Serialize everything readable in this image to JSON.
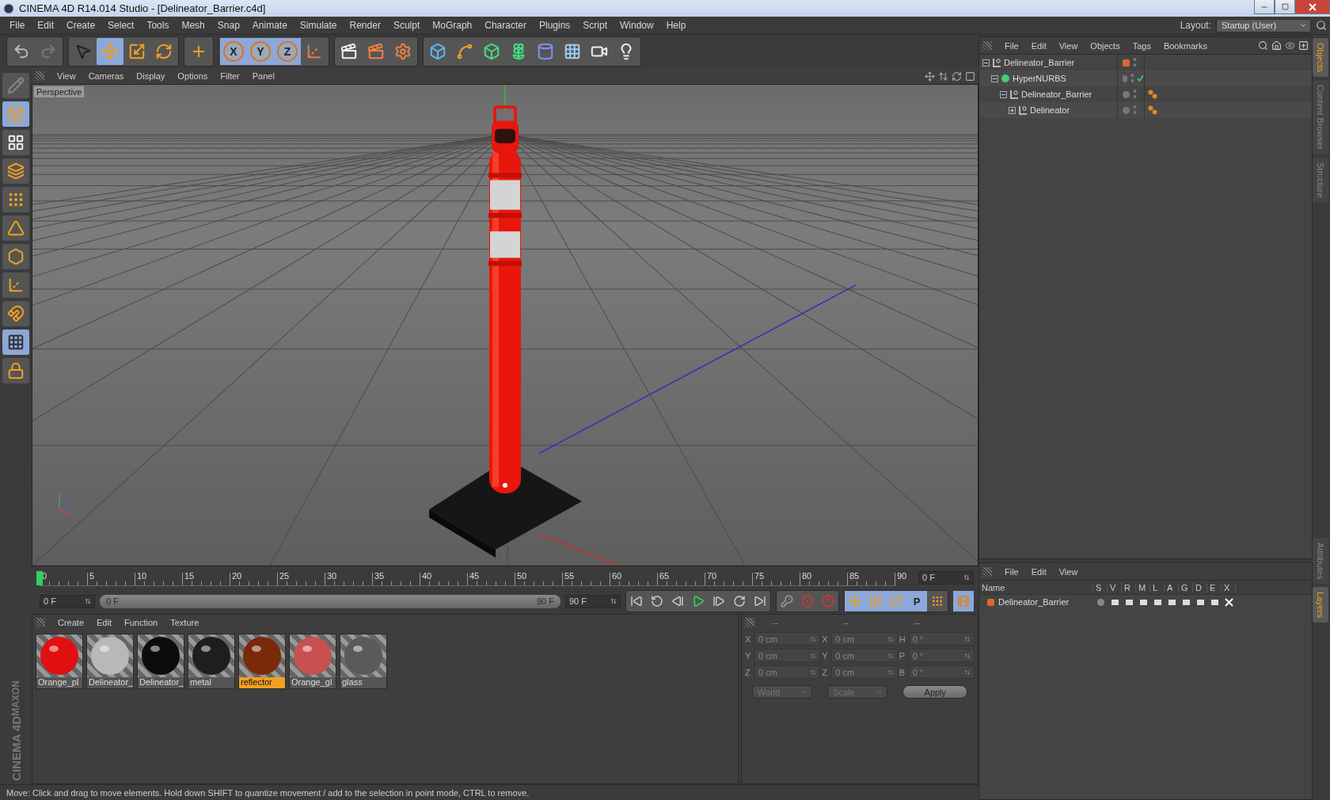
{
  "window": {
    "title": "CINEMA 4D R14.014 Studio - [Delineator_Barrier.c4d]"
  },
  "menu": [
    "File",
    "Edit",
    "Create",
    "Select",
    "Tools",
    "Mesh",
    "Snap",
    "Animate",
    "Simulate",
    "Render",
    "Sculpt",
    "MoGraph",
    "Character",
    "Plugins",
    "Script",
    "Window",
    "Help"
  ],
  "layout": {
    "label": "Layout:",
    "value": "Startup (User)"
  },
  "toolbar": {
    "history": [
      {
        "kind": "undo",
        "disabled": false
      },
      {
        "kind": "redo",
        "disabled": true
      }
    ],
    "tools": [
      {
        "kind": "select",
        "selected": false
      },
      {
        "kind": "move",
        "selected": true
      },
      {
        "kind": "scale",
        "selected": false
      },
      {
        "kind": "rotate",
        "selected": false
      }
    ],
    "extra": [
      {
        "kind": "add"
      }
    ],
    "axes": [
      {
        "label": "X",
        "selected": true
      },
      {
        "label": "Y",
        "selected": true
      },
      {
        "label": "Z",
        "selected": true
      }
    ],
    "render": [
      {
        "kind": "render_view"
      },
      {
        "kind": "render_picture"
      },
      {
        "kind": "render_settings"
      }
    ],
    "objects": [
      {
        "kind": "cube"
      },
      {
        "kind": "spline"
      },
      {
        "kind": "nurbs"
      },
      {
        "kind": "array"
      },
      {
        "kind": "deformer"
      },
      {
        "kind": "floor"
      },
      {
        "kind": "camera"
      },
      {
        "kind": "light"
      }
    ]
  },
  "left_tools": [
    {
      "kind": "edit",
      "selected": false
    },
    {
      "kind": "model",
      "selected": true
    },
    {
      "kind": "texture",
      "selected": false
    },
    {
      "kind": "workplane",
      "selected": false
    },
    {
      "kind": "points",
      "selected": false
    },
    {
      "kind": "edges",
      "selected": false
    },
    {
      "kind": "polygons",
      "selected": false
    },
    {
      "kind": "axis",
      "selected": false
    },
    {
      "kind": "magnet",
      "selected": false
    },
    {
      "kind": "snap",
      "selected": true
    },
    {
      "kind": "lock",
      "selected": false
    }
  ],
  "logo": {
    "brand": "MAXON",
    "product": "CINEMA 4D"
  },
  "viewport": {
    "menu": [
      "View",
      "Cameras",
      "Display",
      "Options",
      "Filter",
      "Panel"
    ],
    "label": "Perspective"
  },
  "timeline": {
    "labels": [
      "0",
      "5",
      "10",
      "15",
      "20",
      "25",
      "30",
      "35",
      "40",
      "45",
      "50",
      "55",
      "60",
      "65",
      "70",
      "75",
      "80",
      "85",
      "90"
    ],
    "playhead": {
      "level": 0
    },
    "frame": "0 F"
  },
  "transport": {
    "start": "0 F",
    "range": {
      "start": "0 F",
      "end": "90 F",
      "level": 1
    },
    "end": "90 F",
    "playback": [
      {
        "kind": "first"
      },
      {
        "kind": "prev_key"
      },
      {
        "kind": "prev_frame"
      },
      {
        "kind": "play"
      },
      {
        "kind": "next_frame"
      },
      {
        "kind": "next_key"
      },
      {
        "kind": "last"
      }
    ],
    "keys": [
      {
        "kind": "key",
        "selected": false
      },
      {
        "kind": "record",
        "selected": false
      },
      {
        "kind": "auto",
        "selected": false
      }
    ],
    "channels": [
      {
        "kind": "move",
        "selected": true
      },
      {
        "kind": "scale",
        "selected": true
      },
      {
        "kind": "rotate",
        "selected": true
      },
      {
        "kind": "param",
        "label": "P",
        "selected": true
      },
      {
        "kind": "points",
        "selected": false
      }
    ]
  },
  "materials": {
    "menu": [
      "Create",
      "Edit",
      "Function",
      "Texture"
    ],
    "items": [
      {
        "name": "Orange_pl",
        "color": "#e01010",
        "selected": false
      },
      {
        "name": "Delineator_",
        "color": "#b8b8b8",
        "selected": false
      },
      {
        "name": "Delineator_",
        "color": "#0c0c0c",
        "selected": false
      },
      {
        "name": "metal",
        "color": "#1e1e1e",
        "selected": false
      },
      {
        "name": "reflector",
        "color": "#7a2a08",
        "selected": true
      },
      {
        "name": "Orange_gl",
        "color": "#c85050",
        "selected": false
      },
      {
        "name": "glass",
        "color": "#5a5a5a",
        "selected": false
      }
    ]
  },
  "coordinates": {
    "headers": [
      "--",
      "--",
      "--"
    ],
    "rows": [
      {
        "fields": [
          {
            "label": "X",
            "value": "0 cm"
          },
          {
            "label": "X",
            "value": "0 cm"
          },
          {
            "label": "H",
            "value": "0 °"
          }
        ]
      },
      {
        "fields": [
          {
            "label": "Y",
            "value": "0 cm"
          },
          {
            "label": "Y",
            "value": "0 cm"
          },
          {
            "label": "P",
            "value": "0 °"
          }
        ]
      },
      {
        "fields": [
          {
            "label": "Z",
            "value": "0 cm"
          },
          {
            "label": "Z",
            "value": "0 cm"
          },
          {
            "label": "B",
            "value": "0 °"
          }
        ]
      }
    ],
    "dropdowns": [
      "World",
      "Scale"
    ],
    "apply": "Apply"
  },
  "object_manager": {
    "menu": [
      "File",
      "Edit",
      "View",
      "Objects",
      "Tags",
      "Bookmarks"
    ],
    "objects": [
      {
        "name": "Delineator_Barrier",
        "kind": "null",
        "expanded": true,
        "color": "#d8692c",
        "checked": false,
        "tagged": false,
        "children": [
          {
            "name": "HyperNURBS",
            "kind": "nurbs",
            "expanded": true,
            "checked": true,
            "tagged": false,
            "children": [
              {
                "name": "Delineator_Barrier",
                "kind": "null",
                "expanded": true,
                "checked": false,
                "tagged": true,
                "children": [
                  {
                    "name": "Delineator",
                    "kind": "null",
                    "expanded": false,
                    "checked": false,
                    "tagged": true
                  }
                ]
              }
            ]
          }
        ]
      }
    ]
  },
  "layer_manager": {
    "menu": [
      "File",
      "Edit",
      "View"
    ],
    "columns": [
      "Name",
      "S",
      "V",
      "R",
      "M",
      "L",
      "A",
      "G",
      "D",
      "E",
      "X"
    ],
    "rows": [
      {
        "name": "Delineator_Barrier",
        "color": "#d8692c"
      }
    ]
  },
  "side_tabs": {
    "top": [
      {
        "label": "Objects",
        "selected": true
      },
      {
        "label": "Content Browser",
        "selected": false
      },
      {
        "label": "Structure",
        "selected": false
      }
    ],
    "bottom": [
      {
        "label": "Attributes",
        "selected": false
      },
      {
        "label": "Layers",
        "selected": true
      }
    ]
  },
  "status_bar": "Move: Click and drag to move elements. Hold down SHIFT to quantize movement / add to the selection in point mode, CTRL to remove."
}
